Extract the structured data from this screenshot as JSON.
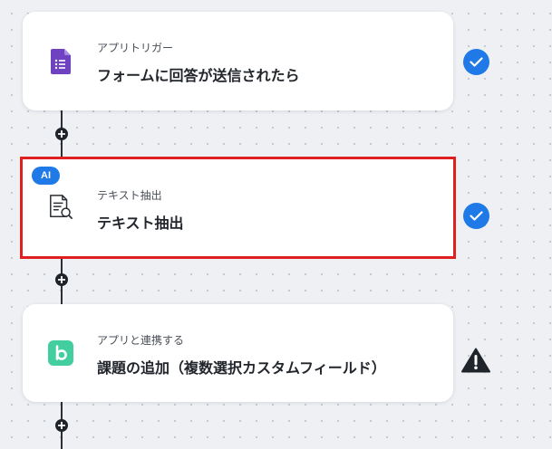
{
  "flow": {
    "steps": [
      {
        "subtitle": "アプリトリガー",
        "title": "フォームに回答が送信されたら",
        "icon": "google-forms-icon",
        "status": "completed"
      },
      {
        "badge": "AI",
        "subtitle": "テキスト抽出",
        "title": "テキスト抽出",
        "icon": "text-extract-document-icon",
        "status": "completed",
        "selected": true
      },
      {
        "subtitle": "アプリと連携する",
        "title": "課題の追加（複数選択カスタムフィールド）",
        "icon": "backlog-icon",
        "status": "warning"
      }
    ]
  },
  "colors": {
    "accent_blue": "#1f7ae8",
    "selection_red": "#e02020",
    "forms_purple": "#6e42c1",
    "backlog_green": "#42ce9f",
    "connector": "#2b2f36"
  },
  "icons": {
    "add_step": "plus-icon",
    "completed": "check-icon",
    "warning": "warning-triangle-icon"
  }
}
